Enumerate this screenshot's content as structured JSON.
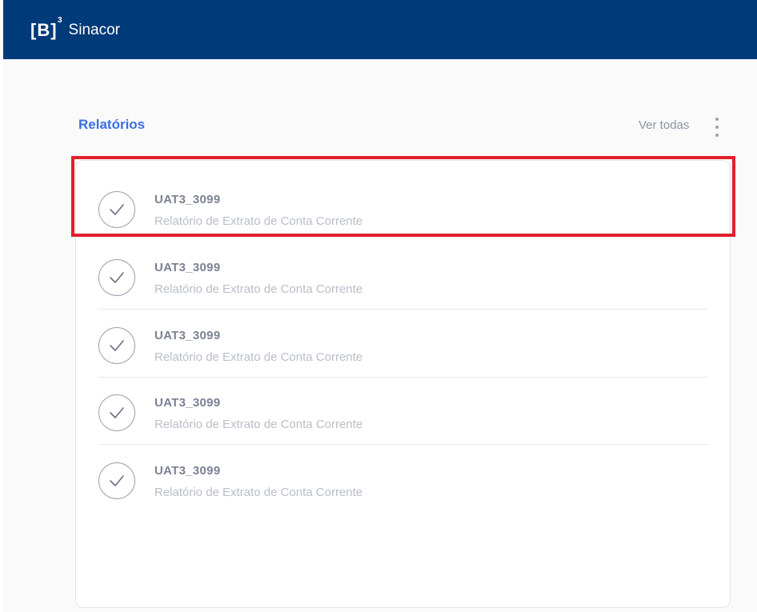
{
  "header": {
    "logo_mark": "[B]",
    "logo_sup": "3",
    "app_name": "Sinacor"
  },
  "section": {
    "title": "Relatórios",
    "see_all_label": "Ver todas",
    "more_icon": "kebab-vertical-icon"
  },
  "colors": {
    "topbar": "#003a78",
    "accent": "#3b6fe3",
    "highlight": "#e0202b"
  },
  "reports": [
    {
      "title": "UAT3_3099",
      "subtitle": "Relatório de Extrato de Conta Corrente",
      "status_icon": "check-circle-icon",
      "highlighted": true
    },
    {
      "title": "UAT3_3099",
      "subtitle": "Relatório de Extrato de Conta Corrente",
      "status_icon": "check-circle-icon",
      "highlighted": false
    },
    {
      "title": "UAT3_3099",
      "subtitle": "Relatório de Extrato de Conta Corrente",
      "status_icon": "check-circle-icon",
      "highlighted": false
    },
    {
      "title": "UAT3_3099",
      "subtitle": "Relatório de Extrato de Conta Corrente",
      "status_icon": "check-circle-icon",
      "highlighted": false
    },
    {
      "title": "UAT3_3099",
      "subtitle": "Relatório de Extrato de Conta Corrente",
      "status_icon": "check-circle-icon",
      "highlighted": false
    }
  ]
}
